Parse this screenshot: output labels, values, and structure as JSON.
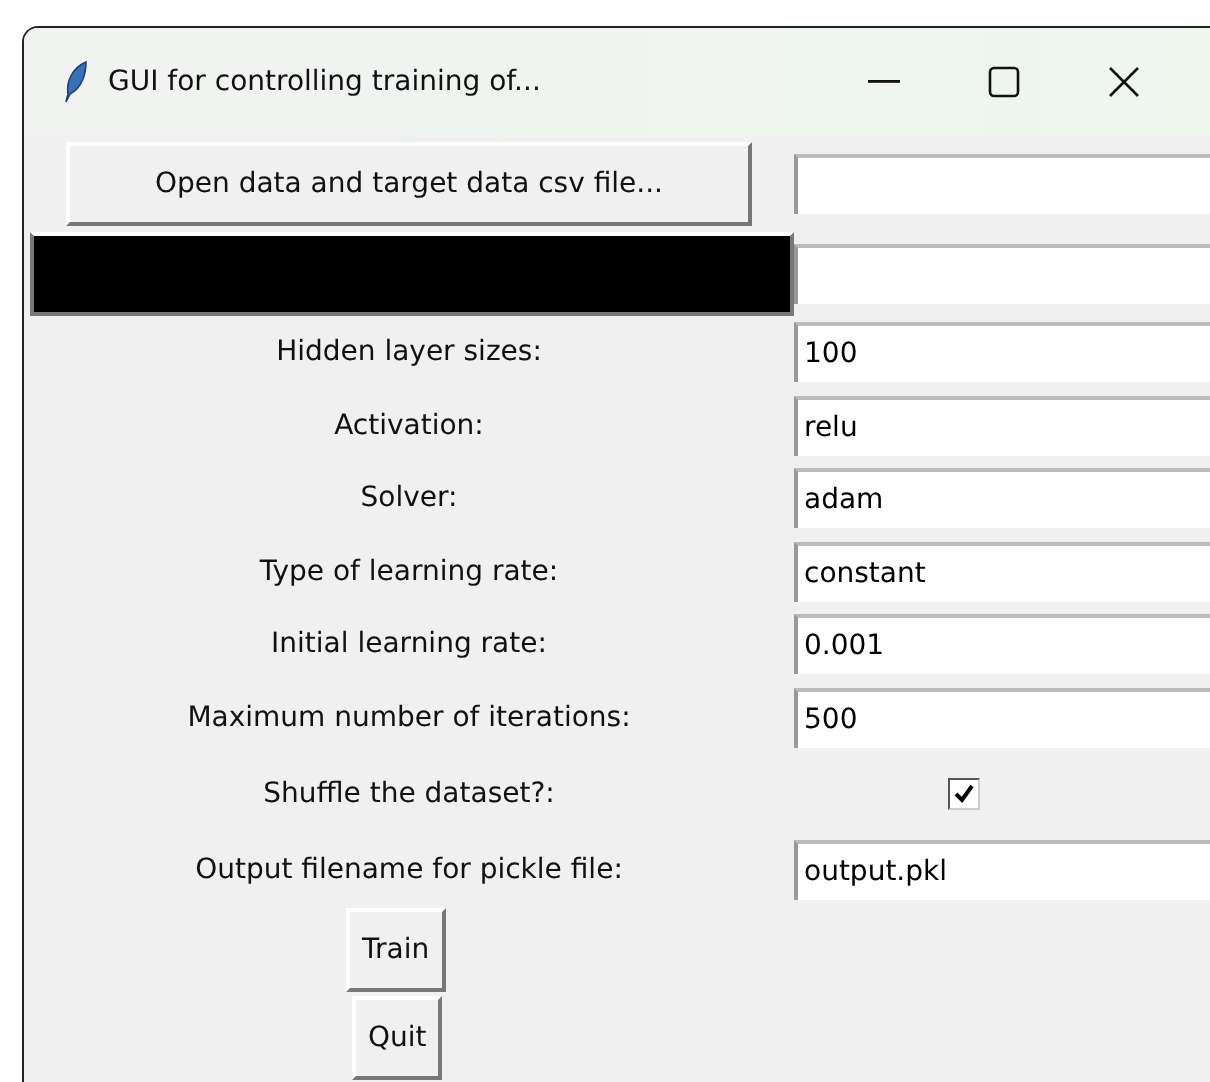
{
  "window": {
    "title": "GUI for controlling training of..."
  },
  "open_button": {
    "label": "Open data and target data csv file..."
  },
  "fields": [
    {
      "kind": "entry",
      "label": "Hidden layer sizes:",
      "value": "100"
    },
    {
      "kind": "entry",
      "label": "Activation:",
      "value": "relu"
    },
    {
      "kind": "entry",
      "label": "Solver:",
      "value": "adam"
    },
    {
      "kind": "entry",
      "label": "Type of learning rate:",
      "value": "constant"
    },
    {
      "kind": "entry",
      "label": "Initial learning rate:",
      "value": "0.001"
    },
    {
      "kind": "entry",
      "label": "Maximum number of iterations:",
      "value": "500"
    },
    {
      "kind": "checkbox",
      "label": "Shuffle the dataset?:",
      "checked": true
    },
    {
      "kind": "entry",
      "label": "Output filename for pickle file:",
      "value": "output.pkl"
    }
  ],
  "buttons": [
    "Train",
    "Quit"
  ]
}
